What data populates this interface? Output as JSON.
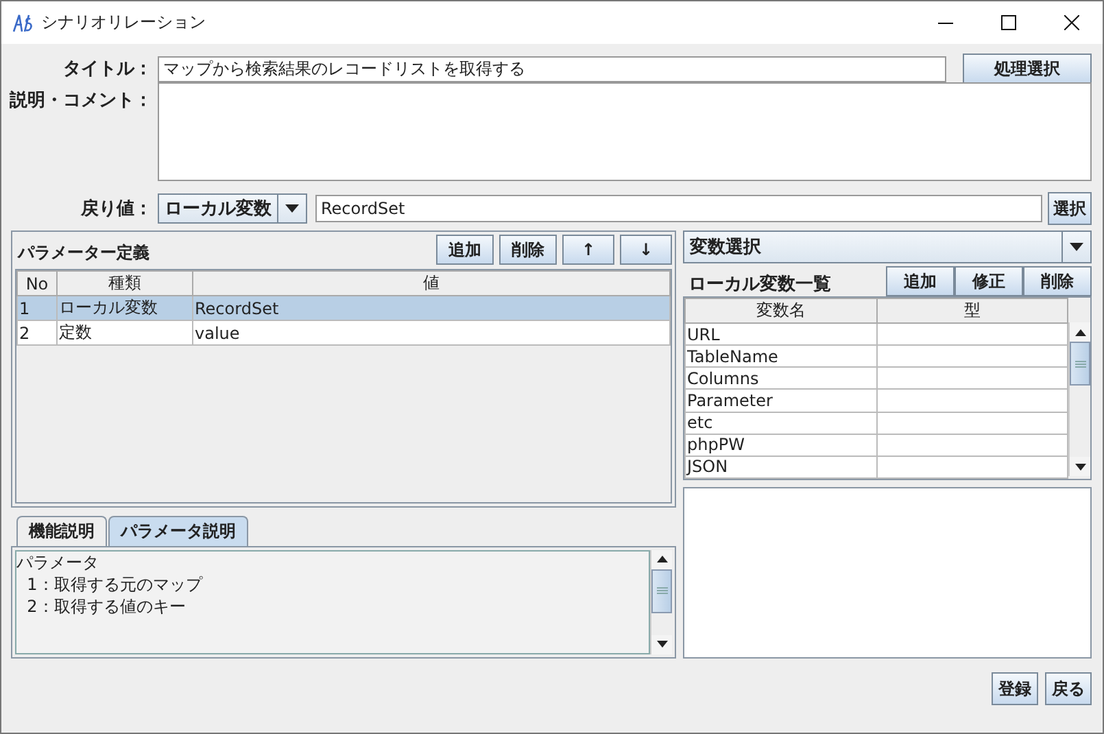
{
  "window": {
    "title": "シナリオリレーション"
  },
  "title_field": {
    "label": "タイトル：",
    "value": "マップから検索結果のレコードリストを取得する"
  },
  "process_button": "処理選択",
  "comment": {
    "label": "説明・コメント："
  },
  "return_value": {
    "label": "戻り値：",
    "type": "ローカル変数",
    "value": "RecordSet",
    "button": "選択"
  },
  "parameters": {
    "title": "パラメーター定義",
    "buttons": [
      "追加",
      "削除",
      "↑",
      "↓"
    ],
    "columns": [
      "No",
      "種類",
      "値"
    ],
    "rows": [
      {
        "no": "1",
        "kind": "ローカル変数",
        "value": "RecordSet",
        "selected": true
      },
      {
        "no": "2",
        "kind": "定数",
        "value": "value",
        "selected": false
      }
    ]
  },
  "description_tabs": [
    {
      "label": "機能説明",
      "selected": false
    },
    {
      "label": "パラメータ説明",
      "selected": true
    }
  ],
  "description_lines": [
    "パラメータ",
    "  1：取得する元のマップ",
    "  2：取得する値のキー"
  ],
  "variable_select": {
    "value": "変数選択"
  },
  "local_variables": {
    "title": "ローカル変数一覧",
    "buttons": [
      "追加",
      "修正",
      "削除"
    ],
    "columns": [
      "変数名",
      "型"
    ],
    "rows": [
      {
        "name": "URL"
      },
      {
        "name": "TableName"
      },
      {
        "name": "Columns"
      },
      {
        "name": "Parameter"
      },
      {
        "name": "etc"
      },
      {
        "name": "phpPW"
      },
      {
        "name": "JSON"
      }
    ]
  },
  "footer_buttons": [
    "登録",
    "戻る"
  ]
}
